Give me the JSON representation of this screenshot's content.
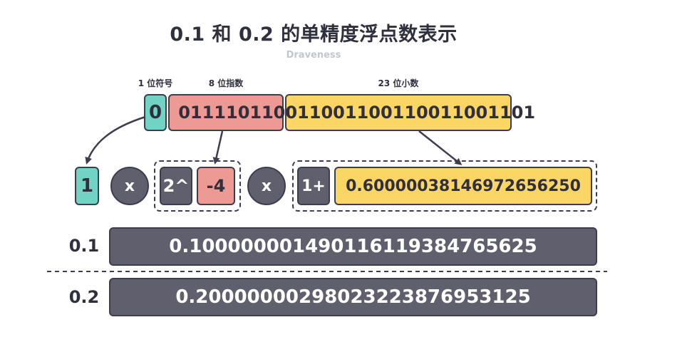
{
  "header": {
    "title": "0.1 和 0.2 的单精度浮点数表示",
    "subtitle": "Draveness"
  },
  "bits": {
    "sign_label": "1 位符号",
    "exponent_label": "8 位指数",
    "fraction_label": "23 位小数",
    "sign_value": "0",
    "exponent_value": "01111011",
    "fraction_value": "10011001100110011001101"
  },
  "formula": {
    "sign": "1",
    "times1": "x",
    "base": "2^",
    "exponent": "-4",
    "times2": "x",
    "implicit": "1+",
    "mantissa": "0.60000038146972656250"
  },
  "results": [
    {
      "label": "0.1",
      "value": "0.100000001490116119384765625"
    },
    {
      "label": "0.2",
      "value": "0.20000000298023223876953125"
    }
  ],
  "colors": {
    "teal": "#70d3c3",
    "pink": "#ee9a94",
    "yellow": "#fbd664",
    "dark": "#5f5f6e",
    "outline": "#3d3d4e"
  }
}
